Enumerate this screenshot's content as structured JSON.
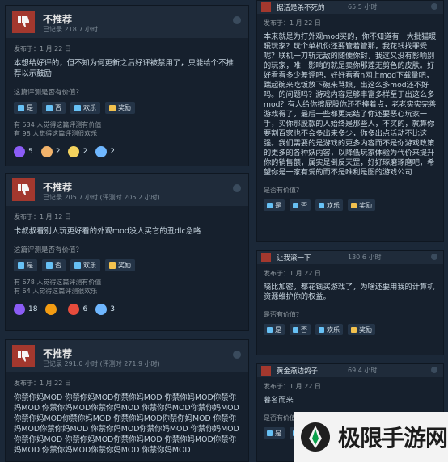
{
  "left_reviews": [
    {
      "rating": "不推荐",
      "hours": "已记录 218.7 小时",
      "posted": "发布于：1 月 22 日",
      "body": "本想给好评的，但不知为何更新之后好评被禁用了，只能给个不推荐以示鼓励",
      "help_q": "这篇评测是否有价值？",
      "buttons": [
        "是",
        "否",
        "欢乐",
        "奖励"
      ],
      "stats": [
        "有 534 人觉得这篇评测有价值",
        "有 98 人觉得这篇评测很欢乐"
      ],
      "awards": [
        {
          "icon": "purple-hands-icon",
          "count": "5"
        },
        {
          "icon": "trophy-icon",
          "count": "2"
        },
        {
          "icon": "diamond-icon",
          "count": "2"
        },
        {
          "icon": "medal-icon",
          "count": "2"
        }
      ]
    },
    {
      "rating": "不推荐",
      "hours": "已记录 205.7 小时 (评测时 205.2 小时)",
      "posted": "发布于：1 月 12 日",
      "body": "卡叔叔看别人玩更好看的外观mod没人买它的丑dlc急咯",
      "help_q": "这篇评测是否有价值？",
      "buttons": [
        "是",
        "否",
        "欢乐",
        "奖励"
      ],
      "stats": [
        "有 678 人觉得这篇评测有价值",
        "有 64 人觉得这篇评测很欢乐"
      ],
      "awards": [
        {
          "icon": "purple-hands-icon",
          "count": "18"
        },
        {
          "icon": "flex-arm-icon",
          "count": ""
        },
        {
          "icon": "face-icon",
          "count": "6"
        },
        {
          "icon": "medal-icon",
          "count": "3"
        }
      ]
    },
    {
      "rating": "不推荐",
      "hours": "已记录 291.0 小时 (评测时 271.9 小时)",
      "posted": "发布于：1 月 22 日",
      "body": "你禁你妈MOD 你禁你妈MOD你禁你妈MOD 你禁你妈MOD你禁你妈MOD 你禁你妈MOD你禁你妈MOD 你禁你妈MOD你禁你妈MOD 你禁你妈MOD你禁你妈MOD 你禁你妈MOD你禁你妈MOD 你禁你妈MOD你禁你妈MOD 你禁你妈MOD你禁你妈MOD 你禁你妈MOD你禁你妈MOD 你禁你妈MOD你禁你妈MOD 你禁你妈MOD你禁你妈MOD 你禁你妈MOD你禁你妈MOD 你禁你妈MOD"
    }
  ],
  "right_reviews": [
    {
      "name": "据活是杀不死的",
      "hours": "65.5 小时",
      "posted": "发布于：1 月 22 日",
      "body": "本来就是为打外观mod买的，你不知道有一大批猫暖暖玩家？玩个单机你还要管着管那，我花钱找罪受呢？联机一刀斩无敌的随便你封，我这又没有影响别的玩家，唯一影响的就是卖你那莲无剪色的皮肤。好好看看多少差评吧，好好看看n网上mod下载量吧，踹起碗来吃饭放下碗来骂娘，出这么多mod还不好吗。的问题吗？游戏内容是够丰富多样至于出这么多mod？有人给你擦屁股你还不捧着点，老老实实完善游戏得了，最后一些都更完结了你还要恶心玩家一手，买你那股款的人始终是那些人，不买的，就算你要割百家也不会多出来多少，你多出点活动不比这强。我们需要的是游戏的更多内容而不是你游戏政策的更多的各种妖内容，以降低玩家体验为代价来提升你的销售额，属实是倒反天罡，好好琢磨琢磨吧，希望你是一家有爱的而不是唯利是图的游戏公司",
      "help_q": "是否有价值？",
      "buttons": [
        "是",
        "否",
        "欢乐",
        "奖励"
      ]
    },
    {
      "name": "让我滚一下",
      "hours": "130.6 小时",
      "posted": "发布于：1 月 22 日",
      "body": "晓比加密，都花钱买游戏了，为啥还要用我的计算机资源维护你的权益。",
      "help_q": "是否有价值？",
      "buttons": [
        "是",
        "否",
        "欢乐",
        "奖励"
      ]
    },
    {
      "name": "黄金燕边鸽子",
      "hours": "69.4 小时",
      "posted": "发布于：1 月 22 日",
      "body": "暮名而来",
      "help_q": "是否有价值？",
      "buttons": [
        "是",
        "否",
        "欢乐",
        "奖励"
      ]
    }
  ],
  "brand": {
    "text": "极限手游网"
  }
}
